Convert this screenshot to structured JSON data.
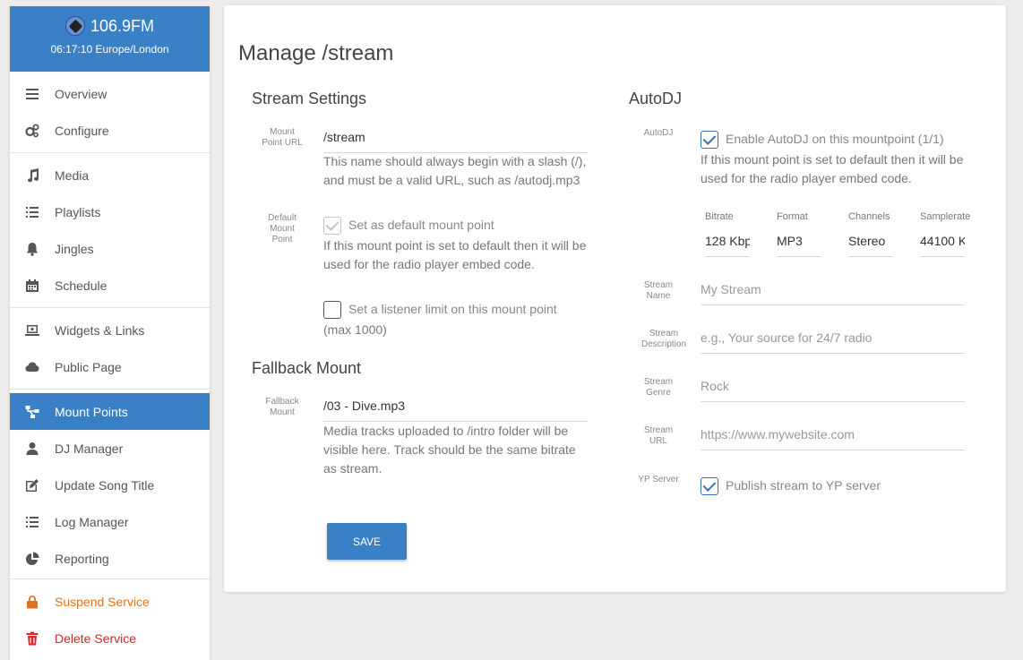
{
  "station": {
    "name": "106.9FM",
    "time": "06:17:10 Europe/London"
  },
  "sidebar": {
    "items": [
      {
        "label": "Overview",
        "icon": "list-icon"
      },
      {
        "label": "Configure",
        "icon": "gears-icon"
      },
      {
        "label": "Media",
        "icon": "music-icon"
      },
      {
        "label": "Playlists",
        "icon": "list-icon"
      },
      {
        "label": "Jingles",
        "icon": "bell-icon"
      },
      {
        "label": "Schedule",
        "icon": "calendar-icon"
      },
      {
        "label": "Widgets & Links",
        "icon": "monitor-icon"
      },
      {
        "label": "Public Page",
        "icon": "cloud-icon"
      },
      {
        "label": "Mount Points",
        "icon": "sitemap-icon"
      },
      {
        "label": "DJ Manager",
        "icon": "user-icon"
      },
      {
        "label": "Update Song Title",
        "icon": "edit-icon"
      },
      {
        "label": "Log Manager",
        "icon": "list-icon"
      },
      {
        "label": "Reporting",
        "icon": "pie-chart-icon"
      },
      {
        "label": "Suspend Service",
        "icon": "lock-icon"
      },
      {
        "label": "Delete Service",
        "icon": "trash-icon"
      }
    ],
    "active": "Mount Points",
    "colors": {
      "header": "#3a80c7",
      "active": "#3a80c7",
      "warn": "#e0731c",
      "danger": "#d9252b"
    }
  },
  "page": {
    "title": "Manage /stream"
  },
  "stream_settings": {
    "title": "Stream Settings",
    "mount_label": "Mount Point URL",
    "mount_value": "/stream",
    "mount_help": "This name should always begin with a slash (/), and must be a valid URL, such as /autodj.mp3",
    "default_label": "Default Mount Point",
    "default_checkbox": "Set as default mount point",
    "default_checked": true,
    "default_help": "If this mount point is set to default then it will be used for the radio player embed code.",
    "limit_checkbox": "Set a listener limit on this mount point",
    "limit_checked": false,
    "limit_help": "(max 1000)"
  },
  "fallback": {
    "title": "Fallback Mount",
    "label": "Fallback Mount",
    "value": "/03 - Dive.mp3",
    "help": "Media tracks uploaded to /intro folder will be visible here. Track should be the same bitrate as stream."
  },
  "autodj": {
    "title": "AutoDJ",
    "label": "AutoDJ",
    "enable_checkbox": "Enable AutoDJ on this mountpoint (1/1)",
    "enable_checked": true,
    "help": "If this mount point is set to default then it will be used for the radio player embed code.",
    "bitrate_label": "Bitrate",
    "bitrate_value": "128 Kbp",
    "format_label": "Format",
    "format_value": "MP3",
    "channels_label": "Channels",
    "channels_value": "Stereo",
    "samplerate_label": "Samplerate",
    "samplerate_value": "44100 K",
    "name_label": "Stream Name",
    "name_placeholder": "My Stream",
    "desc_label": "Stream Description",
    "desc_placeholder": "e.g., Your source for 24/7 radio",
    "genre_label": "Stream Genre",
    "genre_placeholder": "Rock",
    "url_label": "Stream URL",
    "url_placeholder": "https://www.mywebsite.com",
    "yp_label": "YP Server",
    "yp_checkbox": "Publish stream to YP server",
    "yp_checked": true
  },
  "actions": {
    "save_label": "SAVE"
  }
}
